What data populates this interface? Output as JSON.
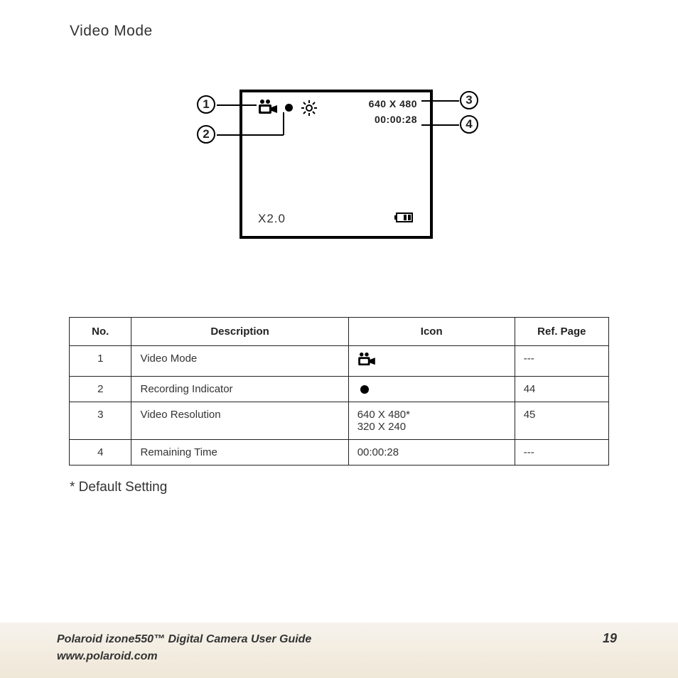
{
  "title": "Video Mode",
  "screen": {
    "resolution": "640 X 480",
    "time": "00:00:28",
    "zoom": "X2.0"
  },
  "callouts": {
    "c1": "1",
    "c2": "2",
    "c3": "3",
    "c4": "4"
  },
  "table": {
    "headers": {
      "no": "No.",
      "desc": "Description",
      "icon": "Icon",
      "ref": "Ref. Page"
    },
    "rows": [
      {
        "no": "1",
        "desc": "Video Mode",
        "iconType": "video",
        "iconText": "",
        "ref": "---"
      },
      {
        "no": "2",
        "desc": "Recording Indicator",
        "iconType": "dot",
        "iconText": "",
        "ref": "44"
      },
      {
        "no": "3",
        "desc": "Video Resolution",
        "iconType": "text",
        "iconText": "640 X 480*\n320 X 240",
        "ref": "45"
      },
      {
        "no": "4",
        "desc": "Remaining Time",
        "iconType": "text",
        "iconText": "00:00:28",
        "ref": "---"
      }
    ]
  },
  "footnote": "* Default Setting",
  "footer": {
    "line1": "Polaroid izone550™ Digital Camera User Guide",
    "line2": "www.polaroid.com",
    "page": "19"
  }
}
